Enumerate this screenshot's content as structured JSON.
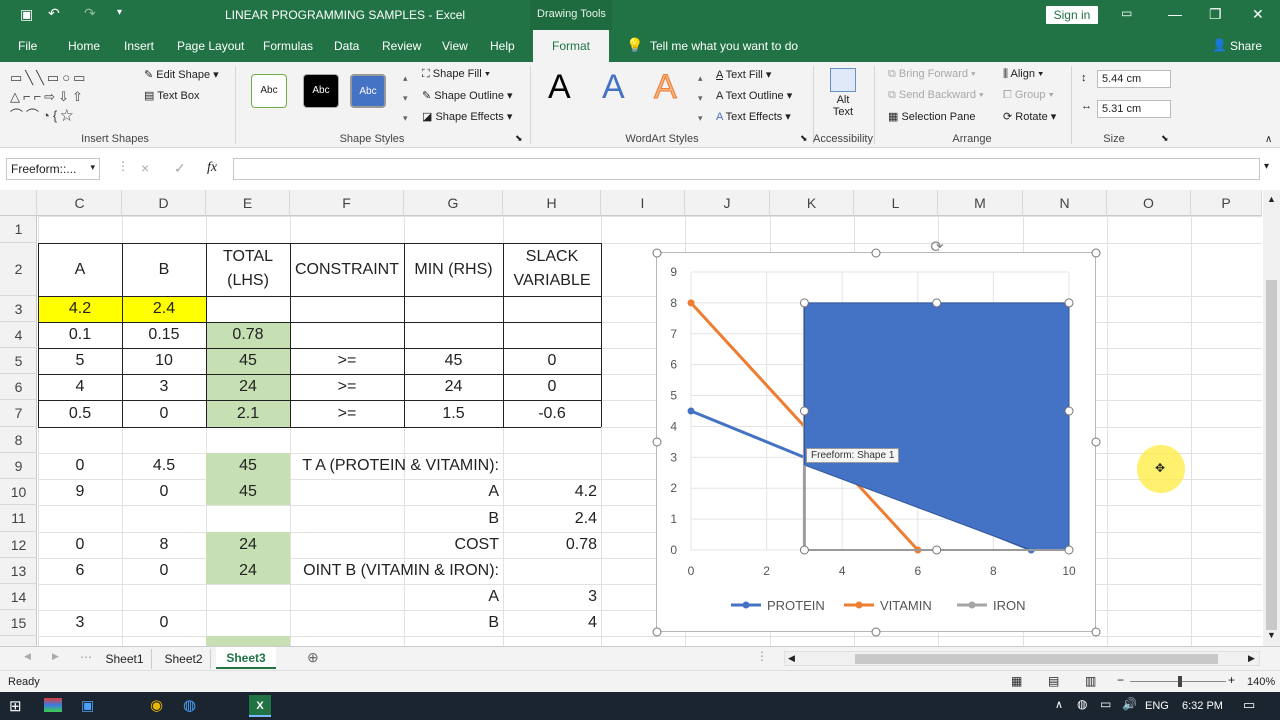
{
  "titlebar": {
    "title": "LINEAR PROGRAMMING SAMPLES  -  Excel",
    "context_tab": "Drawing Tools",
    "sign_in": "Sign in"
  },
  "menu": {
    "items": [
      "File",
      "Home",
      "Insert",
      "Page Layout",
      "Formulas",
      "Data",
      "Review",
      "View",
      "Help"
    ],
    "active": "Format",
    "tell_me": "Tell me what you want to do",
    "share": "Share"
  },
  "ribbon": {
    "edit_shape": "Edit Shape",
    "text_box": "Text Box",
    "insert_shapes": "Insert Shapes",
    "style_samples": [
      "Abc",
      "Abc",
      "Abc"
    ],
    "shape_fill": "Shape Fill",
    "shape_outline": "Shape Outline",
    "shape_effects": "Shape Effects",
    "shape_styles": "Shape Styles",
    "wordart_letters": [
      "A",
      "A",
      "A"
    ],
    "text_fill": "Text Fill",
    "text_outline": "Text Outline",
    "text_effects": "Text Effects",
    "wordart_styles": "WordArt Styles",
    "alt_text_1": "Alt",
    "alt_text_2": "Text",
    "accessibility": "Accessibility",
    "bring_forward": "Bring Forward",
    "send_backward": "Send Backward",
    "selection_pane": "Selection Pane",
    "align": "Align",
    "group": "Group",
    "rotate": "Rotate",
    "arrange": "Arrange",
    "height": "5.44 cm",
    "width": "5.31 cm",
    "size": "Size"
  },
  "formula_bar": {
    "name_box": "Freeform::...",
    "cancel": "×",
    "enter": "✓",
    "fx": "fx",
    "value": ""
  },
  "columns": [
    "C",
    "D",
    "E",
    "F",
    "G",
    "H",
    "I",
    "J",
    "K",
    "L",
    "M",
    "N",
    "O",
    "P"
  ],
  "rows": [
    "1",
    "2",
    "3",
    "4",
    "5",
    "6",
    "7",
    "8",
    "9",
    "10",
    "11",
    "12",
    "13",
    "14",
    "15"
  ],
  "cells": {
    "C2": "A",
    "D2": "B",
    "E2a": "TOTAL",
    "E2b": "(LHS)",
    "F2": "CONSTRAINT",
    "G2": "MIN (RHS)",
    "H2a": "SLACK",
    "H2b": "VARIABLE",
    "C3": "4.2",
    "D3": "2.4",
    "C4": "0.1",
    "D4": "0.15",
    "E4": "0.78",
    "C5": "5",
    "D5": "10",
    "E5": "45",
    "F5": ">=",
    "G5": "45",
    "H5": "0",
    "C6": "4",
    "D6": "3",
    "E6": "24",
    "F6": ">=",
    "G6": "24",
    "H6": "0",
    "C7": "0.5",
    "D7": "0",
    "E7": "2.1",
    "F7": ">=",
    "G7": "1.5",
    "H7": "-0.6",
    "C9": "0",
    "D9": "4.5",
    "E9": "45",
    "F9": "T A (PROTEIN & VITAMIN):",
    "C10": "9",
    "D10": "0",
    "E10": "45",
    "G10": "A",
    "H10": "4.2",
    "G11": "B",
    "H11": "2.4",
    "C12": "0",
    "D12": "8",
    "E12": "24",
    "G12": "COST",
    "H12": "0.78",
    "C13": "6",
    "D13": "0",
    "E13": "24",
    "F13": "OINT B (VITAMIN & IRON):",
    "G14": "A",
    "H14": "3",
    "C15": "3",
    "D15": "0",
    "G15": "B",
    "H15": "4"
  },
  "colors": {
    "excel_green": "#217346",
    "yellow": "#ffff00",
    "light_green": "#c6e0b4",
    "shape_blue": "#4472c4",
    "vitamin_orange": "#ed7d31",
    "iron_gray": "#a5a5a5"
  },
  "shape_tooltip": "Freeform: Shape 1",
  "chart_data": {
    "type": "line",
    "title": "",
    "xlabel": "",
    "ylabel": "",
    "xlim": [
      0,
      10
    ],
    "ylim": [
      0,
      9
    ],
    "x_ticks": [
      "0",
      "2",
      "4",
      "6",
      "8",
      "10"
    ],
    "y_ticks": [
      "0",
      "1",
      "2",
      "3",
      "4",
      "5",
      "6",
      "7",
      "8",
      "9"
    ],
    "series": [
      {
        "name": "PROTEIN",
        "color": "#4472c4",
        "points": [
          [
            0,
            4.5
          ],
          [
            9,
            0
          ]
        ]
      },
      {
        "name": "VITAMIN",
        "color": "#ed7d31",
        "points": [
          [
            0,
            8
          ],
          [
            6,
            0
          ]
        ]
      },
      {
        "name": "IRON",
        "color": "#a5a5a5",
        "points": [
          [
            3,
            0
          ],
          [
            3,
            8
          ]
        ]
      }
    ],
    "legend": "bottom",
    "grid": true
  },
  "sheets": [
    "Sheet1",
    "Sheet2",
    "Sheet3"
  ],
  "active_sheet": "Sheet3",
  "status": {
    "ready": "Ready",
    "zoom": "140%"
  },
  "taskbar": {
    "lang": "ENG",
    "time": "6:32 PM"
  }
}
